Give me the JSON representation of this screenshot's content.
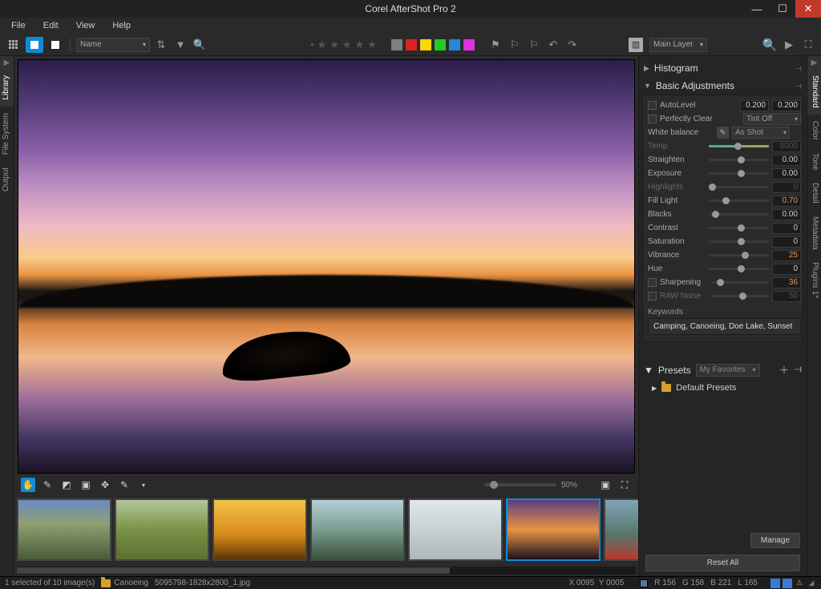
{
  "title": "Corel AfterShot Pro 2",
  "menu": [
    "File",
    "Edit",
    "View",
    "Help"
  ],
  "toolbar": {
    "sort_label": "Name",
    "color_squares": [
      "#808080",
      "#d22",
      "#ffd400",
      "#2c2",
      "#28d",
      "#d3d"
    ],
    "layer_label": "Main Layer"
  },
  "left_panel": {
    "tabs": [
      "Library",
      "File System",
      "Output"
    ]
  },
  "right_panel": {
    "tabs": [
      "Standard",
      "Color",
      "Tone",
      "Detail",
      "Metadata",
      "Plugins 1*"
    ]
  },
  "viewer": {
    "zoom_pct": "50%"
  },
  "adjust": {
    "histogram": "Histogram",
    "basic": "Basic Adjustments",
    "autolevel": {
      "label": "AutoLevel",
      "v1": "0.200",
      "v2": "0.200"
    },
    "perfectly_clear": {
      "label": "Perfectly Clear",
      "combo": "Tint Off"
    },
    "white_balance": {
      "label": "White balance",
      "combo": "As Shot"
    },
    "temp": {
      "label": "Temp",
      "val": "5000"
    },
    "straighten": {
      "label": "Straighten",
      "val": "0.00"
    },
    "exposure": {
      "label": "Exposure",
      "val": "0.00"
    },
    "highlights": {
      "label": "Highlights",
      "val": "0"
    },
    "fill": {
      "label": "Fill Light",
      "val": "0.70"
    },
    "blacks": {
      "label": "Blacks",
      "val": "0.00"
    },
    "contrast": {
      "label": "Contrast",
      "val": "0"
    },
    "saturation": {
      "label": "Saturation",
      "val": "0"
    },
    "vibrance": {
      "label": "Vibrance",
      "val": "25"
    },
    "hue": {
      "label": "Hue",
      "val": "0"
    },
    "sharpening": {
      "label": "Sharpening",
      "val": "36"
    },
    "rawnoise": {
      "label": "RAW Noise",
      "val": "50"
    },
    "keywords_label": "Keywords",
    "keywords": "Camping, Canoeing, Doe Lake, Sunset"
  },
  "presets": {
    "title": "Presets",
    "combo": "My Favorites",
    "default": "Default Presets",
    "manage": "Manage",
    "reset": "Reset All"
  },
  "status": {
    "sel": "1 selected of 10 image(s)",
    "folder": "Canoeing",
    "filename": "5095798-1828x2800_1.jpg",
    "x": "X 0095",
    "y": "Y 0005",
    "r": "R    156",
    "g": "G    158",
    "b": "B    221",
    "l": "L    165"
  },
  "thumbs": [
    {
      "g": "linear-gradient(180deg,#6a8ac6 0%,#8fa070 40%,#4a5c38 100%)"
    },
    {
      "g": "linear-gradient(180deg,#b3c79e 0%,#7a9246 50%,#5b7030 100%)"
    },
    {
      "g": "linear-gradient(180deg,#f5c349 0%,#d58a1a 60%,#5a3408 100%)"
    },
    {
      "g": "linear-gradient(180deg,#b7cfd6 0%,#7a9c8f 50%,#3b523d 100%)"
    },
    {
      "g": "linear-gradient(180deg,#dfe8ed 0%,#aeb7b9 100%)"
    },
    {
      "g": "linear-gradient(180deg,#5a3f7e 0%,#eb9344 50%,#1a1222 100%)"
    },
    {
      "g": "linear-gradient(180deg,#7fa5b8 0%,#587468 60%,#b8392f 100%)"
    }
  ]
}
